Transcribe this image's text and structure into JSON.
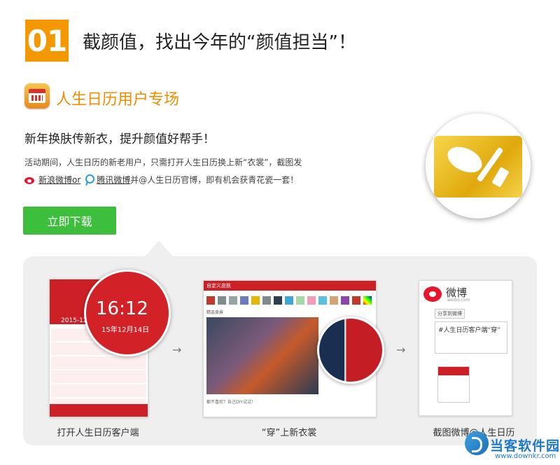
{
  "step": {
    "number": "01",
    "title": "截颜值，找出今年的“颜值担当”！"
  },
  "app": {
    "name": "人生日历用户专场",
    "icon": "calendar-app-icon"
  },
  "tagline": "新年换肤传新衣，提升颜值好帮手！",
  "description": {
    "line1": "活动期间，人生日历的新老用户，只需打开人生日历换上新“衣裳”，截图发",
    "weibo_link": "新浪微博or",
    "tencent_link": "腾讯微博",
    "line2_rest": "并@人生日历官博，即有机会获青花瓷一套！"
  },
  "download_button": "立即下载",
  "steps": [
    {
      "caption": "打开人生日历客户端",
      "time": "16:12",
      "date": "15年12月14日",
      "month": "2015-12"
    },
    {
      "caption": "“穿”上新衣裳",
      "dialog_title": "自定义皮肤",
      "section_label": "精选背景",
      "footer_text": "都不喜欢？自己DIY试试！"
    },
    {
      "caption": "截图微博@人生日历",
      "brand": "微博",
      "brand_url": "weibo.com",
      "tab_label": "分享到微博",
      "compose_text": "#人生日历客户端“穿”"
    }
  ],
  "arrows": [
    "→",
    "→"
  ],
  "watermark": {
    "name": "当客软件园",
    "url": "www.downkr.com"
  },
  "colors": {
    "accent_orange": "#f39800",
    "button_green": "#3dbf3d",
    "calendar_red": "#cc2026",
    "weibo_red": "#e6162d"
  }
}
